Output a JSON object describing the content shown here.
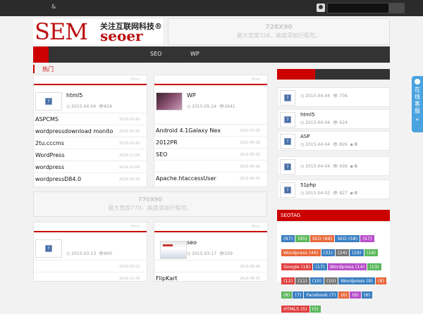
{
  "topbar": {
    "amp": "&",
    "search_placeholder": ""
  },
  "logo": {
    "big": "SEM",
    "cn": "关注互联网科技®",
    "sub": "seoer"
  },
  "ad_top": {
    "size": "728X90",
    "text": "最大宽度728，高度添加行程范。"
  },
  "nav": {
    "items": [
      "SEO",
      "WP"
    ]
  },
  "section_title": "热门",
  "card1": {
    "more": "More",
    "feature": {
      "title": "html5",
      "date": "2015-04-04",
      "views": "624"
    },
    "rows": [
      {
        "title": "ASPCMS",
        "date": "2015-03-30"
      },
      {
        "title": "wordpressdownload monito",
        "date": "2015-03-30"
      },
      {
        "title": "2tu.cccms",
        "date": "2015-03-30"
      },
      {
        "title": "WordPress",
        "date": "2014-11-04"
      },
      {
        "title": "wordpress",
        "date": "2014-11-04"
      },
      {
        "title": "wordpressD84.0",
        "date": "2014-10-19"
      }
    ]
  },
  "card2": {
    "more": "More",
    "feature": {
      "title": "WP",
      "date": "2015-05-24",
      "views": "2641"
    },
    "rows": [
      {
        "title": "Android 4.1Galaxy Nex",
        "date": "2012-07-20"
      },
      {
        "title": "2012PR",
        "date": "2012-06-28"
      },
      {
        "title": "SEO",
        "date": "2015-05-02"
      },
      {
        "title": "",
        "date": "2015-04-26"
      },
      {
        "title": "Apache.htaccessUser",
        "date": "2015-04-01"
      }
    ]
  },
  "ad_mid": {
    "size": "770X90",
    "text": "最大宽度770，高度添加行程范。"
  },
  "card3": {
    "more": "More",
    "feature": {
      "title": "",
      "date": "2015-03-13",
      "views": "600"
    },
    "rows": [
      {
        "title": "",
        "date": "2015-03-13"
      },
      {
        "title": "",
        "date": "2014-11-14"
      }
    ]
  },
  "card4": {
    "more": "More",
    "feature": {
      "title": "seo",
      "date": "2015-03-17",
      "views": "559"
    },
    "rows": [
      {
        "title": "",
        "date": "2014-08-06"
      },
      {
        "title": "FlipKart",
        "date": "2014-08-01"
      }
    ]
  },
  "sidebar": {
    "items": [
      {
        "title": "",
        "date": "2015-04-04",
        "views": "704",
        "comments": ""
      },
      {
        "title": "html5",
        "date": "2015-04-04",
        "views": "624",
        "comments": ""
      },
      {
        "title": "ASP",
        "date": "2015-04-04",
        "views": "826",
        "comments": "0"
      },
      {
        "title": "",
        "date": "2015-04-04",
        "views": "659",
        "comments": "0"
      },
      {
        "title": "51php",
        "date": "2015-04-02",
        "views": "827",
        "comments": "0"
      }
    ]
  },
  "seotag": {
    "title": "SEOTAG",
    "tags": [
      {
        "label": "(97)",
        "color": "#3a7fc1"
      },
      {
        "label": "(95)",
        "color": "#5cb85c"
      },
      {
        "label": "SEO (68)",
        "color": "#e8693a"
      },
      {
        "label": "SEO (58)",
        "color": "#3a7fc1"
      },
      {
        "label": "(57)",
        "color": "#b84fc9"
      },
      {
        "label": "Wordpress (49)",
        "color": "#e8693a"
      },
      {
        "label": "(31)",
        "color": "#3a7fc1"
      },
      {
        "label": "(24)",
        "color": "#777"
      },
      {
        "label": "(19)",
        "color": "#3a7fc1"
      },
      {
        "label": "(19)",
        "color": "#5cb85c"
      },
      {
        "label": "Google (18)",
        "color": "#e04040"
      },
      {
        "label": "(17)",
        "color": "#3a7fc1"
      },
      {
        "label": "Wordpress (14)",
        "color": "#b84fc9"
      },
      {
        "label": "(13)",
        "color": "#5cb85c"
      },
      {
        "label": "(12)",
        "color": "#e04040"
      },
      {
        "label": "(11)",
        "color": "#777"
      },
      {
        "label": "(10)",
        "color": "#3a7fc1"
      },
      {
        "label": "(10)",
        "color": "#777"
      },
      {
        "label": "Wordpress (9)",
        "color": "#3a7fc1"
      },
      {
        "label": "(8)",
        "color": "#e8693a"
      },
      {
        "label": "(8)",
        "color": "#5cb85c"
      },
      {
        "label": "(7)",
        "color": "#3a7fc1"
      },
      {
        "label": "Facebook (7)",
        "color": "#3a7fc1"
      },
      {
        "label": "(6)",
        "color": "#e8693a"
      },
      {
        "label": "(6)",
        "color": "#b84fc9"
      },
      {
        "label": "(6)",
        "color": "#3a7fc1"
      },
      {
        "label": "HTML5 (5)",
        "color": "#e04040"
      },
      {
        "label": "(5)",
        "color": "#5cb85c"
      }
    ]
  },
  "service": {
    "text": "在线客服"
  }
}
